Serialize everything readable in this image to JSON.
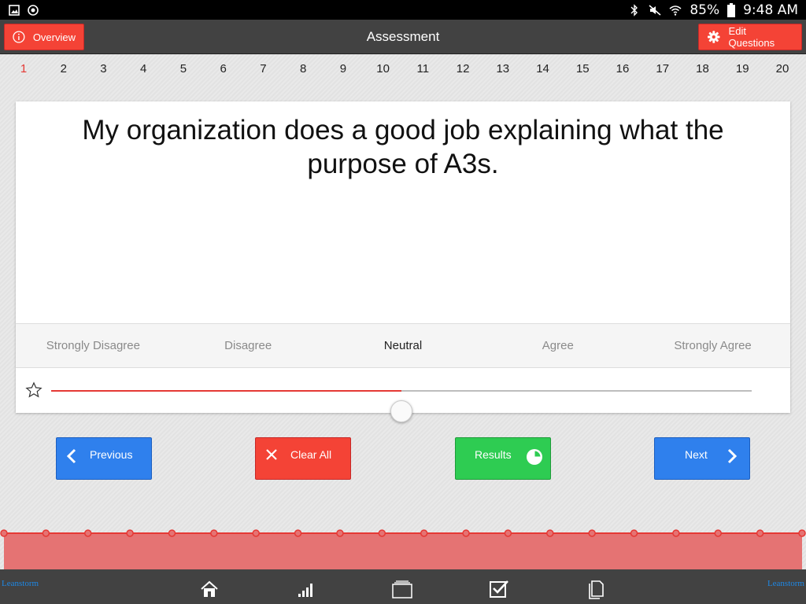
{
  "status": {
    "battery": "85%",
    "time": "9:48 AM"
  },
  "header": {
    "title": "Assessment",
    "overview_label": "Overview",
    "edit_label": "Edit Questions",
    "accent": "#f44336"
  },
  "questions": {
    "numbers": [
      "1",
      "2",
      "3",
      "4",
      "5",
      "6",
      "7",
      "8",
      "9",
      "10",
      "11",
      "12",
      "13",
      "14",
      "15",
      "16",
      "17",
      "18",
      "19",
      "20"
    ],
    "active": 1
  },
  "card": {
    "question": "My organization does a good job explaining what the purpose of A3s.",
    "scale": [
      "Strongly Disagree",
      "Disagree",
      "Neutral",
      "Agree",
      "Strongly Agree"
    ],
    "selected": "Neutral",
    "slider_fraction": 0.5
  },
  "actions": {
    "previous": "Previous",
    "clear": "Clear All",
    "results": "Results",
    "next": "Next"
  },
  "progress": {
    "points": 20,
    "colors": {
      "line": "#e53935",
      "fill": "#e57373"
    }
  },
  "bottom": {
    "logo": "Leanstorm"
  }
}
